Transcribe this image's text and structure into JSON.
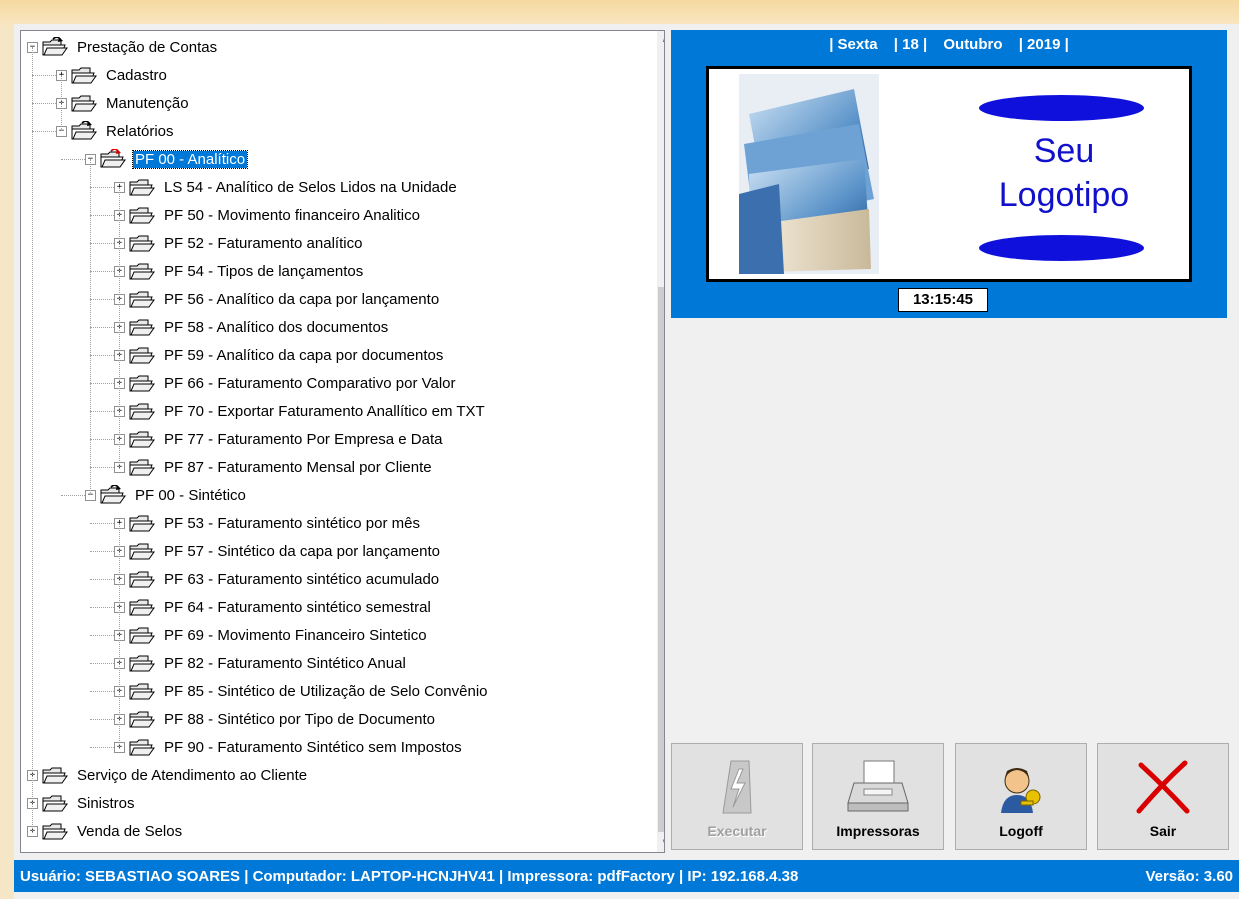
{
  "tree": {
    "items": [
      {
        "label": "Prestação de Contas",
        "expander": "−"
      },
      {
        "label": "Cadastro",
        "expander": "+"
      },
      {
        "label": "Manutenção",
        "expander": "+"
      },
      {
        "label": "Relatórios",
        "expander": "−"
      },
      {
        "label": "PF 00 - Analítico",
        "expander": "−",
        "selected": true
      },
      {
        "label": "LS 54 - Analítico de Selos Lidos na Unidade",
        "expander": "+"
      },
      {
        "label": "PF 50 - Movimento financeiro Analitico",
        "expander": "+"
      },
      {
        "label": "PF 52 - Faturamento analítico",
        "expander": "+"
      },
      {
        "label": "PF 54 - Tipos de lançamentos",
        "expander": "+"
      },
      {
        "label": "PF 56 - Analítico da capa por lançamento",
        "expander": "+"
      },
      {
        "label": "PF 58 - Analítico dos documentos",
        "expander": "+"
      },
      {
        "label": "PF 59 - Analítico da capa por documentos",
        "expander": "+"
      },
      {
        "label": "PF 66 - Faturamento Comparativo por Valor",
        "expander": "+"
      },
      {
        "label": "PF 70 - Exportar Faturamento Anallítico em TXT",
        "expander": "+"
      },
      {
        "label": "PF 77 - Faturamento Por Empresa e Data",
        "expander": "+"
      },
      {
        "label": "PF 87 - Faturamento Mensal por Cliente",
        "expander": "+"
      },
      {
        "label": "PF 00 - Sintético",
        "expander": "−"
      },
      {
        "label": "PF 53 - Faturamento sintético por mês",
        "expander": "+"
      },
      {
        "label": "PF 57 - Sintético da capa por lançamento",
        "expander": "+"
      },
      {
        "label": "PF 63 - Faturamento sintético acumulado",
        "expander": "+"
      },
      {
        "label": "PF 64 - Faturamento sintético semestral",
        "expander": "+"
      },
      {
        "label": "PF 69 - Movimento Financeiro Sintetico",
        "expander": "+"
      },
      {
        "label": "PF 82 - Faturamento Sintético Anual",
        "expander": "+"
      },
      {
        "label": "PF 85 - Sintético de Utilização de Selo Convênio",
        "expander": "+"
      },
      {
        "label": "PF 88 - Sintético por Tipo de Documento",
        "expander": "+"
      },
      {
        "label": "PF 90 - Faturamento Sintético sem Impostos",
        "expander": "+"
      },
      {
        "label": "Serviço de Atendimento ao Cliente",
        "expander": "+"
      },
      {
        "label": "Sinistros",
        "expander": "+"
      },
      {
        "label": "Venda de Selos",
        "expander": "+"
      }
    ]
  },
  "header": {
    "weekday": "| Sexta",
    "day": "| 18 |",
    "month": "Outubro",
    "year": "| 2019 |",
    "clock": "13:15:45"
  },
  "logo": {
    "line1": "Seu",
    "line2": "Logotipo"
  },
  "buttons": {
    "execute": "Executar",
    "printers": "Impressoras",
    "logoff": "Logoff",
    "exit": "Sair"
  },
  "status": {
    "left": "Usuário: SEBASTIAO SOARES | Computador: LAPTOP-HCNJHV41 | Impressora: pdfFactory | IP: 192.168.4.38",
    "version": "Versão: 3.60"
  },
  "colors": {
    "accent": "#0078d7",
    "logo_text": "#1111cc"
  }
}
